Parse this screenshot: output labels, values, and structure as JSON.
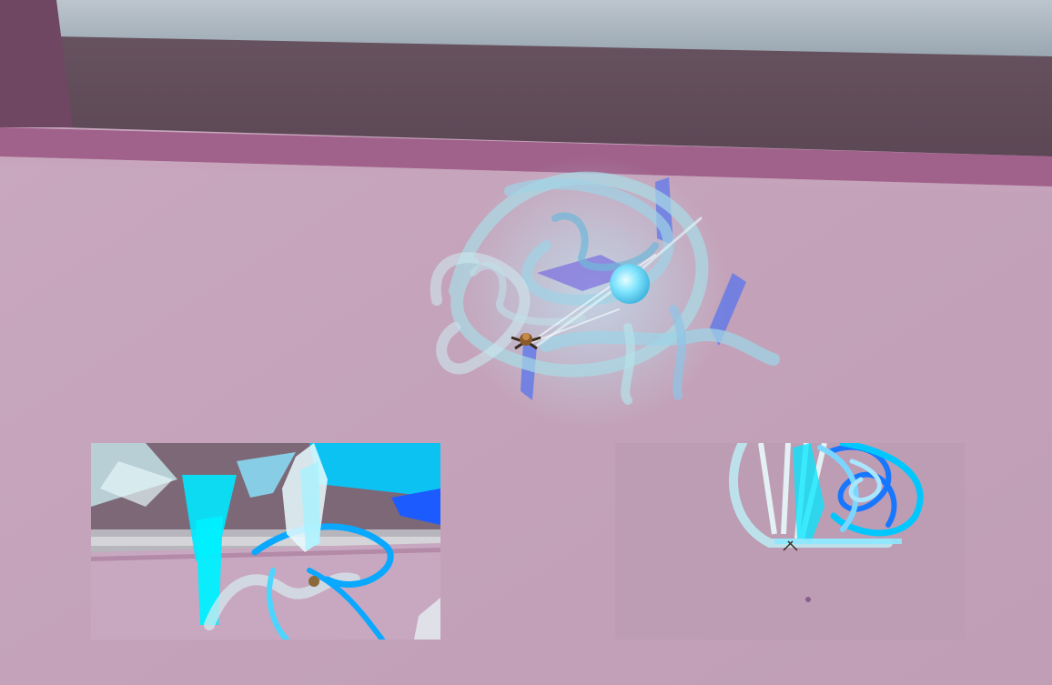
{
  "scene": {
    "kind": "3d-room",
    "colors": {
      "ceiling": "#bcc9d1",
      "back_wall": "#5f4a58",
      "left_wall": "#6e4660",
      "wall_trim": "#9a5e85",
      "floor": "#c4a3ba",
      "effect_light": "#a9dbe6",
      "effect_cyan": "#00e4ff",
      "effect_blue": "#1a6dff",
      "effect_violet": "#6a7ee6",
      "orb": "#7fe6ff"
    },
    "entities": [
      {
        "name": "character",
        "state": "casting"
      },
      {
        "name": "energy-orb"
      },
      {
        "name": "scribble-energy-effect"
      }
    ]
  },
  "camera_views": [
    {
      "name": "close-up-camera-view",
      "subject": "energy-burst"
    },
    {
      "name": "top-down-camera-view",
      "subject": "energy-swirl"
    }
  ]
}
